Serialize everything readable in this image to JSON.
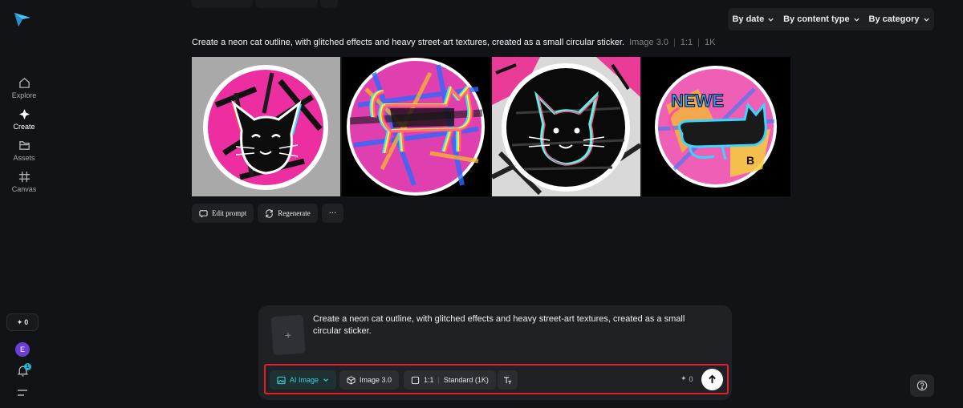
{
  "sidebar": {
    "items": [
      {
        "label": "Explore",
        "icon": "home-icon"
      },
      {
        "label": "Create",
        "icon": "sparkle-icon"
      },
      {
        "label": "Assets",
        "icon": "folder-icon"
      },
      {
        "label": "Canvas",
        "icon": "canvas-icon"
      }
    ],
    "credits": "0",
    "avatar_initial": "E",
    "notification_count": "1"
  },
  "filters": {
    "by_date": "By date",
    "by_content_type": "By content type",
    "by_category": "By category"
  },
  "generation": {
    "prompt": "Create a neon cat outline, with glitched effects and heavy street-art textures, created as a small circular sticker.",
    "model": "Image 3.0",
    "ratio": "1:1",
    "resolution": "1K",
    "actions": {
      "edit": "Edit prompt",
      "regenerate": "Regenerate",
      "more": "···"
    }
  },
  "composer": {
    "upload_symbol": "+",
    "text": "Create a neon cat outline, with glitched effects and heavy street-art textures, created as a small circular sticker.",
    "mode": "AI Image",
    "model": "Image 3.0",
    "ratio": "1:1",
    "quality": "Standard (1K)",
    "credits": "0"
  },
  "colors": {
    "accent_teal": "#3cd3cf",
    "highlight_red": "#e0202a",
    "background": "#121316",
    "panel": "#202125"
  }
}
